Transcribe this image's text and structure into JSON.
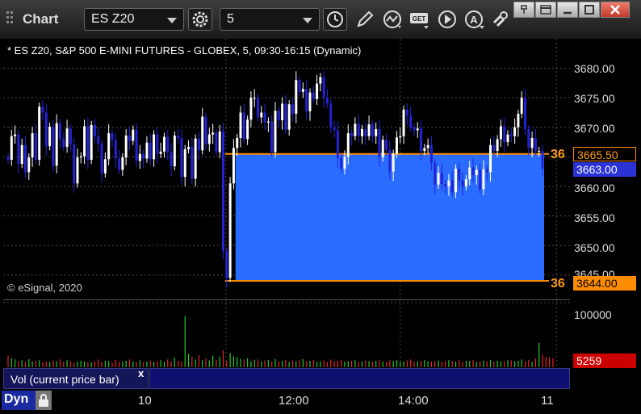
{
  "titlebar": {
    "title": "Chart",
    "symbol": "ES Z20",
    "interval": "5"
  },
  "chart": {
    "header": "* ES Z20, S&P 500 E-MINI FUTURES - GLOBEX, 5, 09:30-16:15 (Dynamic)",
    "copyright": "© eSignal, 2020",
    "price_ticks": [
      "3680.00",
      "3675.00",
      "3670.00",
      "3665.00",
      "3660.00",
      "3655.00",
      "3650.00",
      "3645.00"
    ],
    "upper_level": {
      "value": "3665.50",
      "left_text": "36"
    },
    "current_price": "3663.00",
    "lower_level": {
      "value": "3644.00",
      "left_text": "36"
    },
    "colors": {
      "up": "#ffffff",
      "down": "#2323d6",
      "zone": "#2a6cff",
      "level": "#ff8c00",
      "grid": "#4a4a4a"
    }
  },
  "volume": {
    "label": "Vol (current price bar)",
    "close": "x",
    "scale_tick": "100000",
    "current": "5259"
  },
  "time_axis": {
    "ticks": [
      "10",
      "12:00",
      "14:00",
      "11"
    ]
  },
  "status": {
    "mode": "Dyn"
  },
  "chart_data": {
    "type": "candlestick",
    "ylim": [
      3641,
      3685
    ],
    "price": {
      "open": [
        3665.0,
        3664.5,
        3668.5,
        3668.8,
        3663.8,
        3667.0,
        3662.4,
        3664.9,
        3669.0,
        3664.5,
        3673.5,
        3672.5,
        3666.8,
        3670.1,
        3663.5,
        3670.7,
        3668.0,
        3666.7,
        3669.8,
        3667.1,
        3660.5,
        3664.9,
        3665.1,
        3670.2,
        3664.5,
        3670.4,
        3668.5,
        3667.2,
        3662.2,
        3664.6,
        3669.0,
        3667.9,
        3664.7,
        3662.8,
        3664.9,
        3668.6,
        3667.7,
        3669.6,
        3664.3,
        3665.5,
        3664.7,
        3667.4,
        3664.6,
        3668.8,
        3665.5,
        3665.9,
        3668.4,
        3665.8,
        3663.4,
        3668.6,
        3668.2,
        3661.6,
        3666.3,
        3666.7,
        3661.3,
        3668.1,
        3666.1,
        3671.8,
        3667.2,
        3668.8,
        3669.1,
        3665.8,
        3669.3,
        3649.0,
        3644.5,
        3660.5,
        3666.5,
        3668.2,
        3672.5,
        3668.0,
        3671.3,
        3675.0,
        3675.0,
        3671.7,
        3672.5,
        3670.8,
        3671.0,
        3665.8,
        3672.8,
        3671.2,
        3674.0,
        3669.6,
        3673.9,
        3672.3,
        3678.0,
        3676.0,
        3676.5,
        3672.7,
        3675.9,
        3674.8,
        3677.4,
        3678.5,
        3675.0,
        3674.0,
        3670.0,
        3669.5,
        3664.8,
        3663.0,
        3665.0,
        3669.0,
        3668.5,
        3670.6,
        3668.5,
        3669.7,
        3668.5,
        3670.5,
        3668.5,
        3669.7,
        3664.9,
        3667.9,
        3666.2,
        3662.5,
        3665.5,
        3668.3,
        3668.5,
        3673.0,
        3672.0,
        3670.0,
        3669.5,
        3669.8,
        3666.0,
        3666.5,
        3667.0,
        3664.0,
        3660.3,
        3662.3,
        3660.4,
        3660.0,
        3661.0,
        3659.0,
        3663.0,
        3661.0,
        3660.0,
        3661.2,
        3663.2,
        3661.9,
        3662.8,
        3659.5,
        3662.9,
        3662.4,
        3667.0,
        3666.0,
        3668.0,
        3670.2,
        3667.5,
        3668.8,
        3668.5,
        3670.0,
        3672.3,
        3675.0,
        3669.7,
        3666.5,
        3668.2,
        3666.0,
        3666.0
      ],
      "close": [
        3664.5,
        3668.5,
        3668.8,
        3663.8,
        3667.0,
        3662.4,
        3664.9,
        3669.0,
        3664.5,
        3673.5,
        3672.5,
        3666.8,
        3670.1,
        3663.5,
        3670.7,
        3668.0,
        3666.7,
        3669.8,
        3667.1,
        3660.5,
        3664.9,
        3665.1,
        3670.2,
        3664.5,
        3670.4,
        3668.5,
        3667.2,
        3662.2,
        3664.6,
        3669.0,
        3667.9,
        3664.7,
        3662.8,
        3664.9,
        3668.6,
        3667.7,
        3669.6,
        3664.3,
        3665.5,
        3664.7,
        3667.4,
        3664.6,
        3668.8,
        3665.5,
        3665.9,
        3668.4,
        3665.8,
        3663.4,
        3668.6,
        3668.2,
        3661.6,
        3666.3,
        3666.7,
        3661.3,
        3668.1,
        3666.1,
        3671.8,
        3667.2,
        3668.8,
        3669.1,
        3665.8,
        3669.3,
        3649.0,
        3644.5,
        3660.5,
        3666.5,
        3668.2,
        3672.5,
        3668.0,
        3671.3,
        3675.0,
        3675.0,
        3671.7,
        3672.5,
        3670.8,
        3671.0,
        3665.8,
        3672.8,
        3671.2,
        3674.0,
        3669.6,
        3673.9,
        3672.3,
        3678.0,
        3676.0,
        3676.5,
        3672.7,
        3675.9,
        3674.8,
        3677.4,
        3678.5,
        3675.0,
        3674.0,
        3670.0,
        3669.5,
        3664.8,
        3663.0,
        3665.0,
        3669.0,
        3668.5,
        3670.6,
        3668.5,
        3669.7,
        3668.5,
        3670.5,
        3668.5,
        3669.7,
        3664.9,
        3667.9,
        3666.2,
        3662.5,
        3665.5,
        3668.3,
        3668.5,
        3673.0,
        3672.0,
        3670.0,
        3669.5,
        3669.8,
        3666.0,
        3666.5,
        3667.0,
        3664.0,
        3660.3,
        3662.3,
        3660.4,
        3660.0,
        3661.0,
        3659.0,
        3663.0,
        3661.0,
        3660.0,
        3661.2,
        3663.2,
        3661.9,
        3662.8,
        3659.5,
        3662.9,
        3662.4,
        3667.0,
        3666.0,
        3668.0,
        3670.2,
        3667.5,
        3668.8,
        3668.5,
        3670.0,
        3672.3,
        3675.0,
        3669.7,
        3666.5,
        3668.2,
        3666.0,
        3666.0,
        3663.0
      ]
    },
    "volume": {
      "ylim": [
        0,
        105000
      ],
      "values": [
        18000,
        14000,
        12000,
        9500,
        11000,
        8000,
        12500,
        9000,
        10000,
        11000,
        7500,
        9000,
        8000,
        10500,
        9500,
        12000,
        8000,
        11000,
        9500,
        7000,
        8500,
        10000,
        9000,
        8000,
        7500,
        9000,
        12000,
        8500,
        10000,
        9500,
        7000,
        11500,
        9000,
        8500,
        10000,
        12000,
        9000,
        8000,
        11000,
        7500,
        9000,
        10500,
        8000,
        9500,
        11000,
        8500,
        12000,
        9000,
        14500,
        10000,
        8000,
        79000,
        21000,
        16000,
        12000,
        18500,
        11000,
        13500,
        10500,
        18000,
        11500,
        16500,
        26000,
        10000,
        22000,
        17000,
        15500,
        13000,
        12000,
        14000,
        9500,
        11500,
        12000,
        9000,
        10500,
        11500,
        8500,
        13000,
        9000,
        10000,
        11500,
        8000,
        10500,
        9500,
        11000,
        12500,
        9000,
        10000,
        11500,
        8500,
        9500,
        10500,
        8000,
        12000,
        9000,
        10000,
        11500,
        8500,
        9500,
        10000,
        11000,
        8000,
        9000,
        10500,
        9500,
        8500,
        10000,
        11500,
        9000,
        8000,
        10500,
        9500,
        11000,
        8500,
        9000,
        10500,
        12000,
        9000,
        8500,
        10000,
        11000,
        9000,
        8500,
        9500,
        10500,
        8000,
        9500,
        11000,
        10000,
        9000,
        11500,
        8500,
        10000,
        9500,
        11000,
        8000,
        9000,
        10500,
        9500,
        11500,
        9000,
        10000,
        8500,
        9500,
        11000,
        10500,
        9000,
        10000,
        12000,
        9500,
        11000,
        8500,
        13000,
        38000,
        19000,
        16000,
        15000,
        14000
      ]
    }
  }
}
